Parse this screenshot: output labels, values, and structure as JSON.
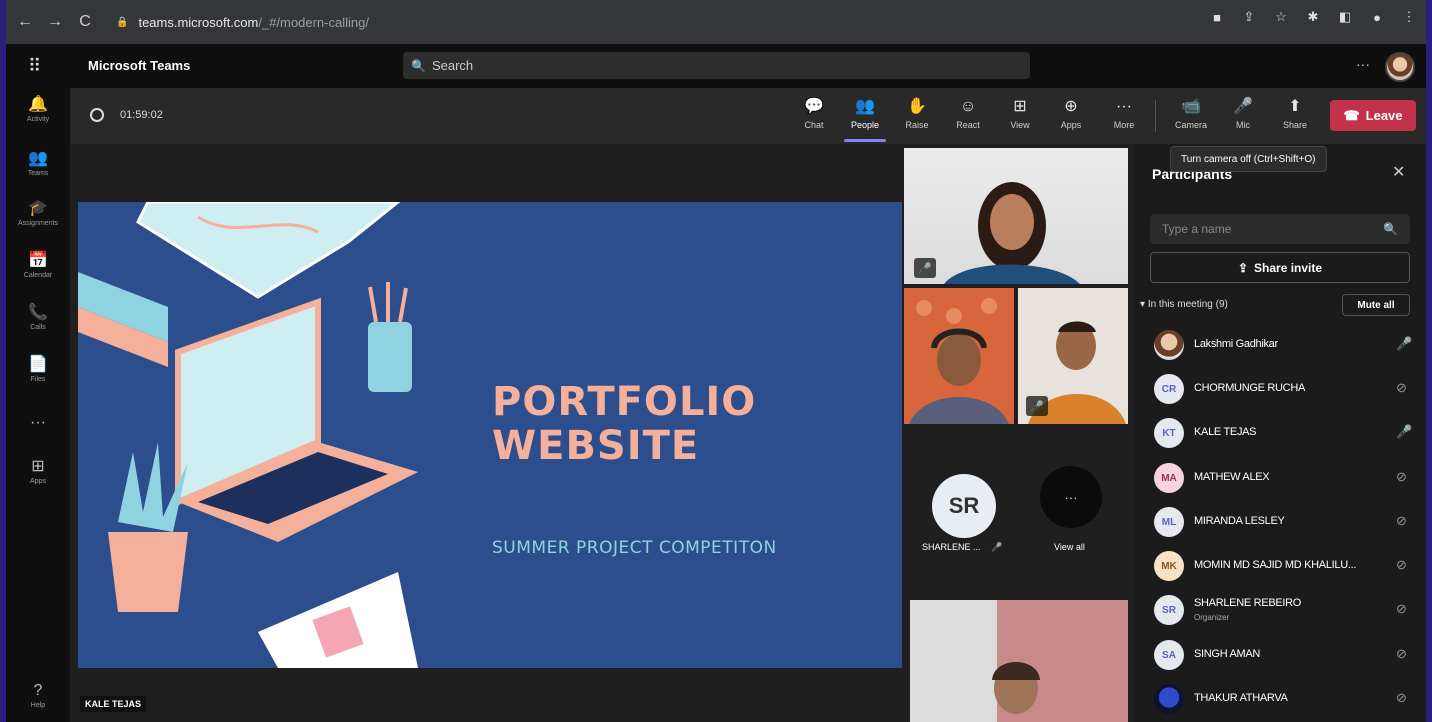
{
  "browser": {
    "url_host": "teams.microsoft.com",
    "url_path": "/_#/modern-calling/"
  },
  "header": {
    "app_title": "Microsoft Teams",
    "search_placeholder": "Search",
    "more": "···"
  },
  "rail": [
    {
      "icon": "bell-icon",
      "glyph": "🔔",
      "label": "Activity"
    },
    {
      "icon": "teams-icon",
      "glyph": "👥",
      "label": "Teams"
    },
    {
      "icon": "assignments-icon",
      "glyph": "🎓",
      "label": "Assignments"
    },
    {
      "icon": "calendar-icon",
      "glyph": "📅",
      "label": "Calendar"
    },
    {
      "icon": "calls-icon",
      "glyph": "📞",
      "label": "Calls"
    },
    {
      "icon": "files-icon",
      "glyph": "📄",
      "label": "Files"
    },
    {
      "icon": "more-icon",
      "glyph": "···",
      "label": ""
    },
    {
      "icon": "apps-icon",
      "glyph": "⊞",
      "label": "Apps"
    },
    {
      "icon": "help-icon",
      "glyph": "?",
      "label": "Help"
    }
  ],
  "meeting": {
    "timer": "01:59:02",
    "toolbar": [
      {
        "name": "chat",
        "glyph": "💬",
        "label": "Chat"
      },
      {
        "name": "people",
        "glyph": "👥",
        "label": "People",
        "active": true
      },
      {
        "name": "raise",
        "glyph": "✋",
        "label": "Raise"
      },
      {
        "name": "react",
        "glyph": "☺",
        "label": "React"
      },
      {
        "name": "view",
        "glyph": "⊞",
        "label": "View"
      },
      {
        "name": "apps",
        "glyph": "⊕",
        "label": "Apps"
      },
      {
        "name": "more",
        "glyph": "···",
        "label": "More"
      },
      {
        "name": "camera",
        "glyph": "📹",
        "label": "Camera"
      },
      {
        "name": "mic",
        "glyph": "🎤",
        "label": "Mic"
      },
      {
        "name": "share",
        "glyph": "⬆",
        "label": "Share"
      }
    ],
    "leave_label": "Leave",
    "camera_tooltip": "Turn camera off (Ctrl+Shift+O)"
  },
  "slide": {
    "title_line1": "PORTFOLIO",
    "title_line2": "WEBSITE",
    "subtitle": "SUMMER PROJECT COMPETITON",
    "presenter_name": "KALE TEJAS"
  },
  "video": {
    "sr_initials": "SR",
    "sr_label": "SHARLENE ...",
    "view_all_label": "View all",
    "view_all_glyph": "···"
  },
  "participants": {
    "title": "Participants",
    "search_placeholder": "Type a name",
    "share_invite": "Share invite",
    "in_meeting": "In this meeting (9)",
    "mute_all": "Mute all",
    "list": [
      {
        "initials": "",
        "name": "Lakshmi Gadhikar",
        "role": "",
        "mic": "on",
        "avatar": "photo"
      },
      {
        "initials": "CR",
        "name": "CHORMUNGE RUCHA",
        "role": "",
        "mic": "muted",
        "avatar": "initials"
      },
      {
        "initials": "KT",
        "name": "KALE TEJAS",
        "role": "",
        "mic": "on",
        "avatar": "initials"
      },
      {
        "initials": "MA",
        "name": "MATHEW ALEX",
        "role": "",
        "mic": "muted",
        "avatar": "ma"
      },
      {
        "initials": "ML",
        "name": "MIRANDA LESLEY",
        "role": "",
        "mic": "muted",
        "avatar": "initials"
      },
      {
        "initials": "MK",
        "name": "MOMIN MD SAJID MD KHALILU...",
        "role": "",
        "mic": "muted",
        "avatar": "mk"
      },
      {
        "initials": "SR",
        "name": "SHARLENE REBEIRO",
        "role": "Organizer",
        "mic": "muted",
        "avatar": "initials"
      },
      {
        "initials": "SA",
        "name": "SINGH AMAN",
        "role": "",
        "mic": "muted",
        "avatar": "initials"
      },
      {
        "initials": "",
        "name": "THAKUR ATHARVA",
        "role": "",
        "mic": "muted",
        "avatar": "blue"
      }
    ]
  },
  "colors": {
    "accent": "#7f85f5",
    "leave": "#c4314b",
    "slide_bg": "#2d4e8c",
    "slide_title": "#f4b09a",
    "slide_sub": "#8fd3e0"
  }
}
